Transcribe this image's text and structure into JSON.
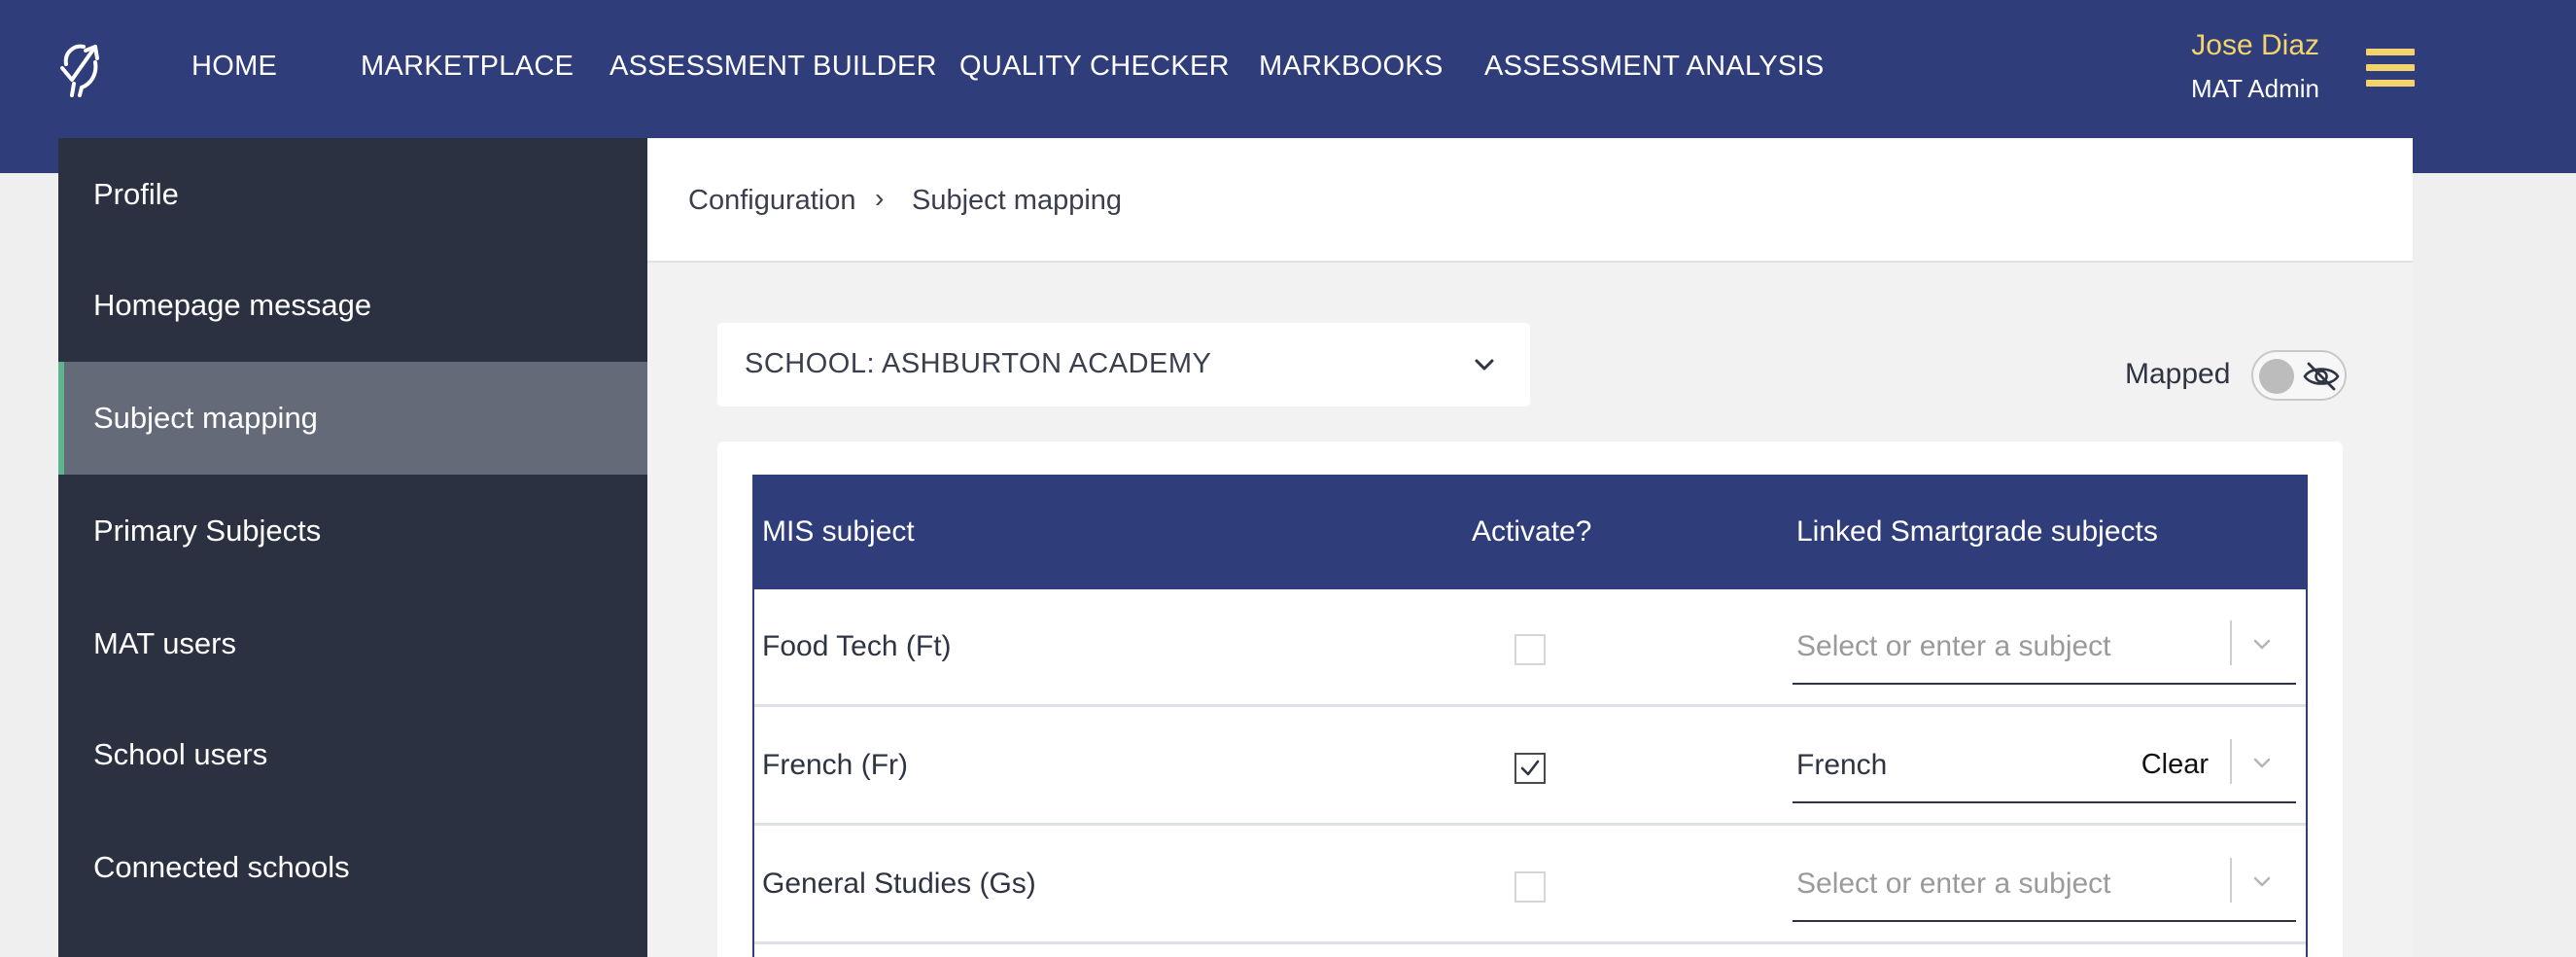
{
  "header": {
    "logo_icon": "smartgrade-logo-icon",
    "nav": [
      {
        "label": "HOME"
      },
      {
        "label": "MARKETPLACE"
      },
      {
        "label": "ASSESSMENT BUILDER"
      },
      {
        "label": "QUALITY CHECKER"
      },
      {
        "label": "MARKBOOKS"
      },
      {
        "label": "ASSESSMENT ANALYSIS"
      }
    ],
    "user": {
      "name": "Jose Diaz",
      "role": "MAT Admin"
    },
    "menu_icon": "hamburger-menu-icon",
    "colors": {
      "bar": "#2f3d7b",
      "accent": "#f3d36b"
    }
  },
  "sidebar": {
    "items": [
      {
        "label": "Profile"
      },
      {
        "label": "Homepage message"
      },
      {
        "label": "Subject mapping",
        "active": true
      },
      {
        "label": "Primary Subjects"
      },
      {
        "label": "MAT users"
      },
      {
        "label": "School users"
      },
      {
        "label": "Connected schools"
      }
    ],
    "colors": {
      "background": "#2c3142",
      "active": "#656a78",
      "active_border": "#5fb48f"
    }
  },
  "breadcrumb": {
    "root": "Configuration",
    "separator": "›",
    "current": "Subject mapping"
  },
  "school_select": {
    "value": "SCHOOL: ASHBURTON ACADEMY",
    "icon": "chevron-down-icon"
  },
  "mapped_toggle": {
    "label": "Mapped",
    "on": false,
    "icon": "eye-off-icon"
  },
  "table": {
    "headers": {
      "mis_subject": "MIS subject",
      "activate": "Activate?",
      "linked": "Linked Smartgrade subjects"
    },
    "rows": [
      {
        "mis_subject": "Food Tech (Ft)",
        "activated": false,
        "linked_placeholder": "Select or enter a subject",
        "linked_value": ""
      },
      {
        "mis_subject": "French (Fr)",
        "activated": true,
        "linked_placeholder": "",
        "linked_value": "French",
        "clear_label": "Clear"
      },
      {
        "mis_subject": "General Studies (Gs)",
        "activated": false,
        "linked_placeholder": "Select or enter a subject",
        "linked_value": ""
      }
    ]
  }
}
